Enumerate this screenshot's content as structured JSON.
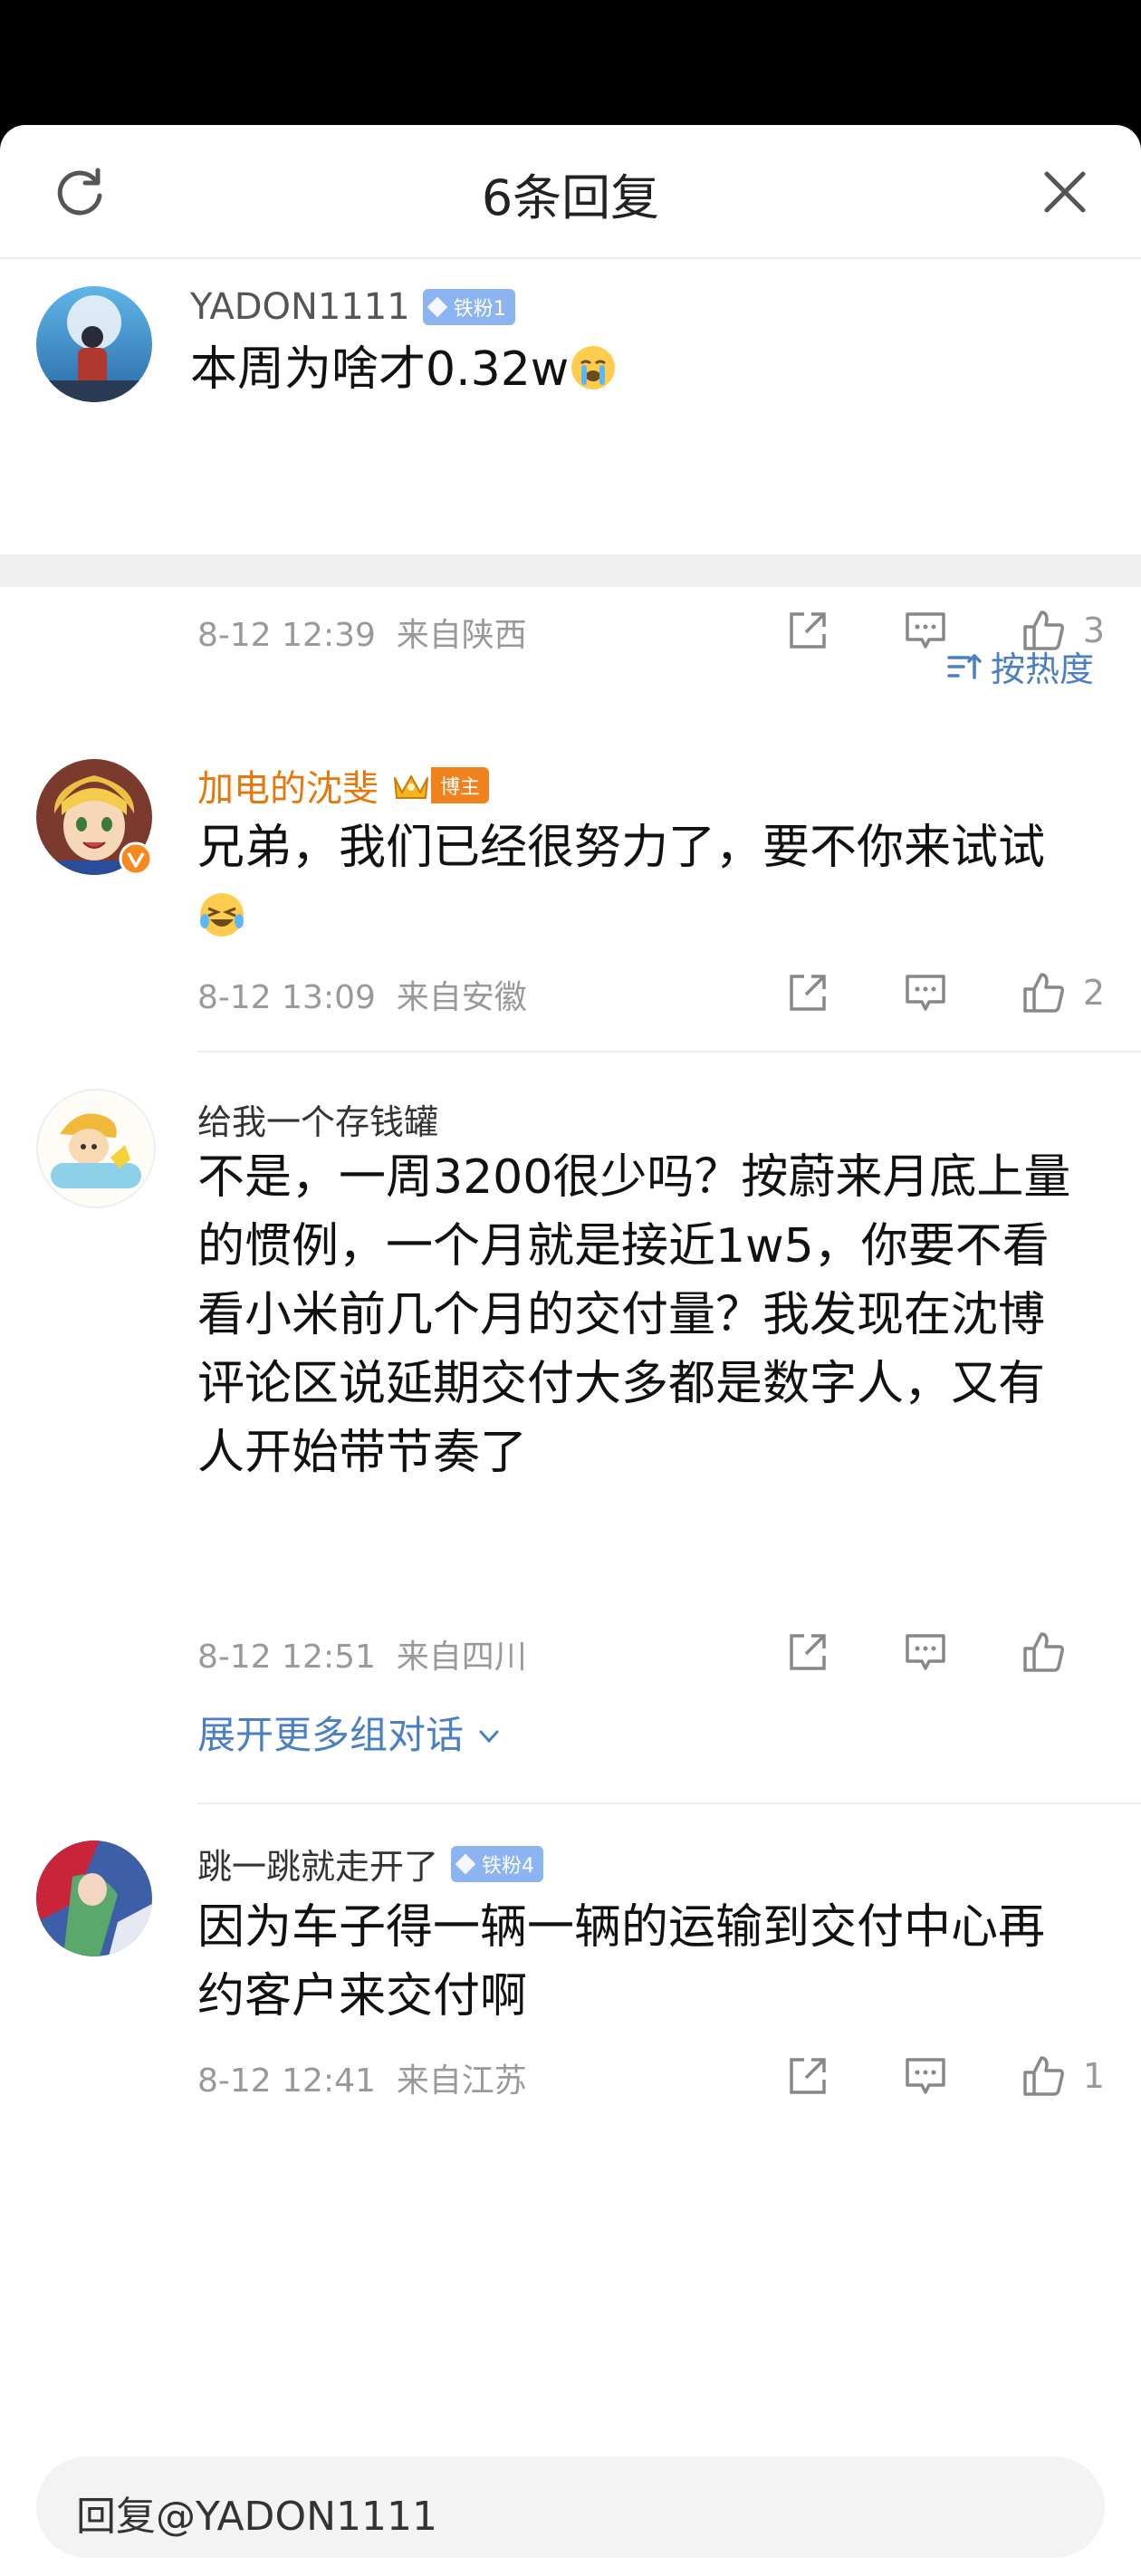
{
  "header": {
    "title": "6条回复"
  },
  "main_comment": {
    "username": "YADON1111",
    "badge": "铁粉1",
    "text": "本周为啥才0.32w",
    "time": "8-12 12:39",
    "location": "来自陕西",
    "likes": "3"
  },
  "sort": {
    "label": "按热度"
  },
  "replies": [
    {
      "username": "加电的沈斐",
      "badge": "博主",
      "text": "兄弟，我们已经很努力了，要不你来试试",
      "time": "8-12 13:09",
      "location": "来自安徽",
      "likes": "2"
    },
    {
      "username": "给我一个存钱罐",
      "text": "不是，一周3200很少吗？按蔚来月底上量的惯例，一个月就是接近1w5，你要不看看小米前几个月的交付量？我发现在沈博评论区说延期交付大多都是数字人，又有人开始带节奏了",
      "time": "8-12 12:51",
      "location": "来自四川",
      "likes": "",
      "expand": "展开更多组对话"
    },
    {
      "username": "跳一跳就走开了",
      "badge": "铁粉4",
      "text": "因为车子得一辆一辆的运输到交付中心再约客户来交付啊",
      "time": "8-12 12:41",
      "location": "来自江苏",
      "likes": "1"
    }
  ],
  "reply_input": {
    "placeholder": "回复@YADON1111"
  },
  "colors": {
    "link": "#4a7fc1",
    "host_orange": "#e8770a",
    "fan_badge": "#8bb4f0"
  },
  "icons": [
    "refresh-icon",
    "close-icon",
    "share-icon",
    "comment-icon",
    "like-icon",
    "sort-icon",
    "crying-emoji",
    "laughing-emoji",
    "chevron-down-icon"
  ]
}
